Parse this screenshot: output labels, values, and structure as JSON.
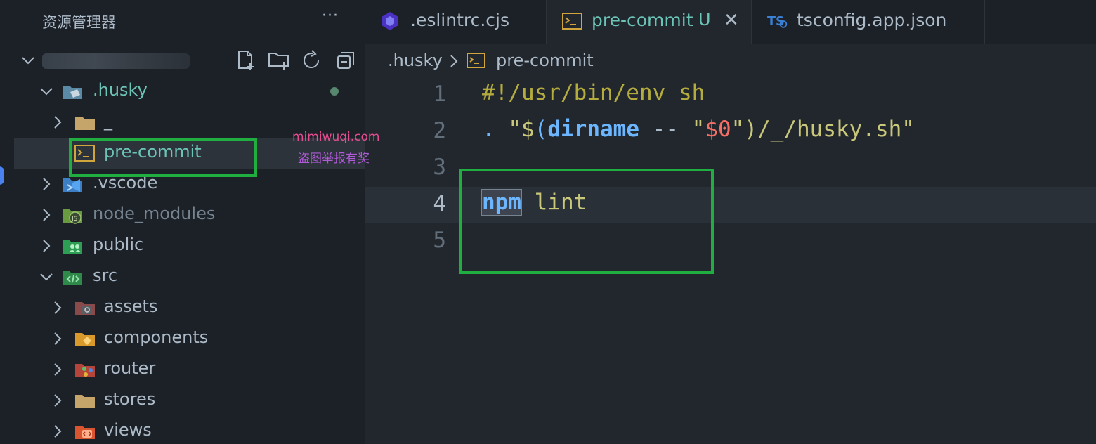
{
  "sidebar": {
    "title": "资源管理器",
    "more_label": "···",
    "tree": [
      {
        "label": ".husky",
        "status_dot": true
      },
      {
        "label": "_"
      },
      {
        "label": "pre-commit"
      },
      {
        "label": ".vscode"
      },
      {
        "label": "node_modules"
      },
      {
        "label": "public"
      },
      {
        "label": "src"
      },
      {
        "label": "assets"
      },
      {
        "label": "components"
      },
      {
        "label": "router"
      },
      {
        "label": "stores"
      },
      {
        "label": "views"
      }
    ]
  },
  "watermark": {
    "line1": "mimiwuqi.com",
    "line2": "盗图举报有奖"
  },
  "tabs": [
    {
      "label": ".eslintrc.cjs"
    },
    {
      "label": "pre-commit",
      "status": "U",
      "close": "✕"
    },
    {
      "label": "tsconfig.app.json"
    }
  ],
  "breadcrumb": {
    "folder": ".husky",
    "file": "pre-commit"
  },
  "editor": {
    "line_numbers": [
      "1",
      "2",
      "3",
      "4",
      "5"
    ],
    "line1": "#!/usr/bin/env sh",
    "line2": {
      "dot": ".",
      "q1": " \"$",
      "paren_open": "(",
      "fn": "dirname",
      "op": " -- ",
      "q2": "\"",
      "var": "$0",
      "q3": "\"",
      "paren_close": ")",
      "rest": "/_/husky.sh\""
    },
    "line4": {
      "cmd": "npm",
      "arg": " lint"
    }
  },
  "colors": {
    "highlight_box": "#1fae3f",
    "sidebar_bg": "#1c2128",
    "editor_bg": "#22272e",
    "accent_teal": "#6bc4b6"
  }
}
